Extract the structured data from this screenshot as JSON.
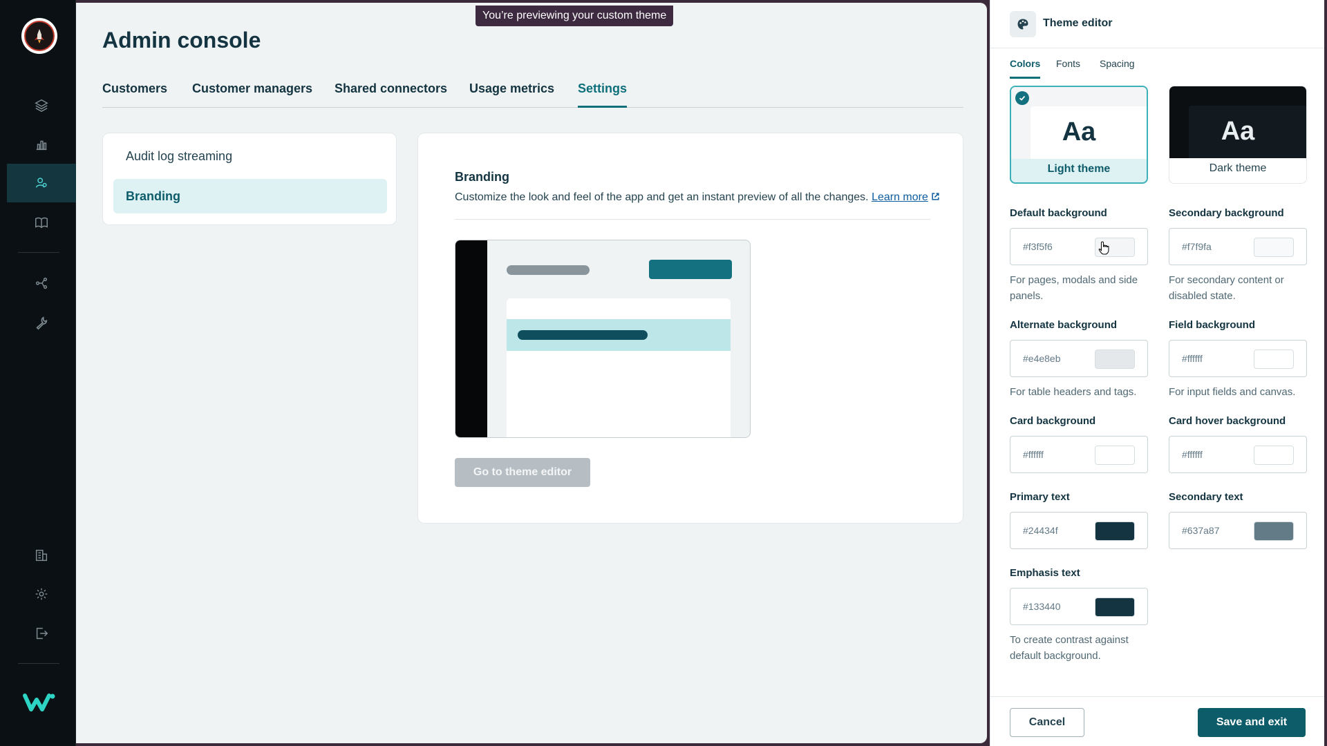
{
  "banner": "You’re previewing your custom theme",
  "page": {
    "title": "Admin console"
  },
  "tabs": [
    {
      "label": "Customers"
    },
    {
      "label": "Customer managers"
    },
    {
      "label": "Shared connectors"
    },
    {
      "label": "Usage metrics"
    },
    {
      "label": "Settings",
      "active": true
    }
  ],
  "settings_nav": [
    {
      "label": "Audit log streaming"
    },
    {
      "label": "Branding",
      "active": true
    }
  ],
  "branding": {
    "title": "Branding",
    "description": "Customize the look and feel of the app and get an instant preview of all the changes.",
    "learn_more": "Learn more",
    "go_button": "Go to theme editor"
  },
  "sidebar": {
    "icons": [
      "layers-icon",
      "bar-chart-icon",
      "users-icon",
      "book-icon",
      "connectors-icon",
      "wrench-icon",
      "building-icon",
      "gear-icon",
      "logout-icon"
    ],
    "active": "users-icon"
  },
  "editor": {
    "title": "Theme editor",
    "tabs": [
      {
        "label": "Colors",
        "active": true
      },
      {
        "label": "Fonts"
      },
      {
        "label": "Spacing"
      }
    ],
    "themes": [
      {
        "sample": "Aa",
        "label": "Light theme",
        "selected": true
      },
      {
        "sample": "Aa",
        "label": "Dark theme"
      }
    ],
    "fields": [
      {
        "label": "Default background",
        "value": "#f3f5f6",
        "color": "#f3f5f6",
        "help": "For pages, modals and side panels."
      },
      {
        "label": "Secondary background",
        "value": "#f7f9fa",
        "color": "#f7f9fa",
        "help": "For secondary content or disabled state."
      },
      {
        "label": "Alternate background",
        "value": "#e4e8eb",
        "color": "#e4e8eb",
        "help": "For table headers and tags."
      },
      {
        "label": "Field background",
        "value": "#ffffff",
        "color": "#ffffff",
        "help": "For input fields and canvas."
      },
      {
        "label": "Card background",
        "value": "#ffffff",
        "color": "#ffffff",
        "help": ""
      },
      {
        "label": "Card hover background",
        "value": "#ffffff",
        "color": "#ffffff",
        "help": ""
      },
      {
        "label": "Primary text",
        "value": "#24434f",
        "color": "#24434f",
        "help": ""
      },
      {
        "label": "Secondary text",
        "value": "#637a87",
        "color": "#637a87",
        "help": ""
      },
      {
        "label": "Emphasis text",
        "value": "#133440",
        "color": "#133440",
        "help": "To create contrast against default background."
      }
    ],
    "cancel": "Cancel",
    "save": "Save and exit"
  },
  "colors": {
    "accent": "#0d5c6a",
    "sidebar_bg": "#0a1014",
    "banner_bg": "#3d2a40"
  }
}
